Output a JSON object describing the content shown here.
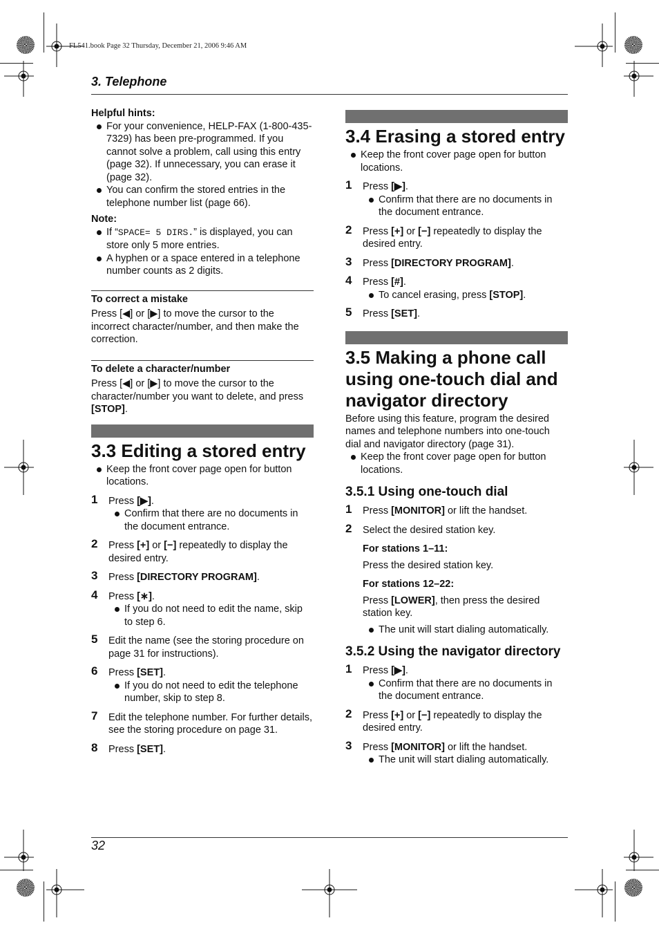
{
  "print_header": "FL541.book  Page 32  Thursday, December 21, 2006  9:46 AM",
  "chapter_title": "3. Telephone",
  "page_number": "32",
  "left": {
    "helpful_hints_title": "Helpful hints:",
    "helpful_hints": [
      "For your convenience, HELP-FAX (1-800-435-7329) has been pre-programmed. If you cannot solve a problem, call using this entry (page 32). If unnecessary, you can erase it (page 32).",
      "You can confirm the stored entries in the telephone number list (page 66)."
    ],
    "note_title": "Note:",
    "note_1_pre": "If “",
    "note_1_mono": "SPACE= 5 DIRS.",
    "note_1_post": "” is displayed, you can store only 5 more entries.",
    "note_2": "A hyphen or a space entered in a telephone number counts as 2 digits.",
    "correct_title": "To correct a mistake",
    "correct_text": "Press [◀] or [▶] to move the cursor to the incorrect character/number, and then make the correction.",
    "delete_title": "To delete a character/number",
    "delete_text_pre": "Press [◀] or [▶] to move the cursor to the character/number you want to delete, and press ",
    "delete_key": "[STOP]",
    "delete_text_post": ".",
    "section_3_3": {
      "title": "3.3 Editing a stored entry",
      "intro": "Keep the front cover page open for button locations.",
      "steps": [
        {
          "num": "1",
          "pre": "Press ",
          "key": "[▶]",
          "post": ".",
          "bullet": "Confirm that there are no documents in the document entrance."
        },
        {
          "num": "2",
          "pre": "Press ",
          "key": "[+]",
          "mid": " or ",
          "key2": "[−]",
          "post": " repeatedly to display the desired entry."
        },
        {
          "num": "3",
          "pre": "Press ",
          "key": "[DIRECTORY PROGRAM]",
          "post": "."
        },
        {
          "num": "4",
          "pre": "Press ",
          "key": "[∗]",
          "post": ".",
          "bullet": "If you do not need to edit the name, skip to step 6."
        },
        {
          "num": "5",
          "text": "Edit the name (see the storing procedure on page 31 for instructions)."
        },
        {
          "num": "6",
          "pre": "Press ",
          "key": "[SET]",
          "post": ".",
          "bullet": "If you do not need to edit the telephone number, skip to step 8."
        },
        {
          "num": "7",
          "text": "Edit the telephone number. For further details, see the storing procedure on page 31."
        },
        {
          "num": "8",
          "pre": "Press ",
          "key": "[SET]",
          "post": "."
        }
      ]
    }
  },
  "right": {
    "section_3_4": {
      "title": "3.4 Erasing a stored entry",
      "intro": "Keep the front cover page open for button locations.",
      "steps": [
        {
          "num": "1",
          "pre": "Press ",
          "key": "[▶]",
          "post": ".",
          "bullet": "Confirm that there are no documents in the document entrance."
        },
        {
          "num": "2",
          "pre": "Press ",
          "key": "[+]",
          "mid": " or ",
          "key2": "[−]",
          "post": " repeatedly to display the desired entry."
        },
        {
          "num": "3",
          "pre": "Press ",
          "key": "[DIRECTORY PROGRAM]",
          "post": "."
        },
        {
          "num": "4",
          "pre": "Press ",
          "key": "[#]",
          "post": ".",
          "bullet_pre": "To cancel erasing, press ",
          "bullet_key": "[STOP]",
          "bullet_post": "."
        },
        {
          "num": "5",
          "pre": "Press ",
          "key": "[SET]",
          "post": "."
        }
      ]
    },
    "section_3_5": {
      "title": "3.5 Making a phone call using one-touch dial and navigator directory",
      "intro": "Before using this feature, program the desired names and telephone numbers into one-touch dial and navigator directory (page 31).",
      "intro_bullet": "Keep the front cover page open for button locations.",
      "sub_1": {
        "title": "3.5.1 Using one-touch dial",
        "step1_pre": "Press ",
        "step1_key": "[MONITOR]",
        "step1_post": " or lift the handset.",
        "step2": "Select the desired station key.",
        "stations_a_label": "For stations 1–11:",
        "stations_a_text": "Press the desired station key.",
        "stations_b_label": "For stations 12–22:",
        "stations_b_pre": "Press ",
        "stations_b_key": "[LOWER]",
        "stations_b_post": ", then press the desired station key.",
        "bullet": "The unit will start dialing automatically."
      },
      "sub_2": {
        "title": "3.5.2 Using the navigator directory",
        "steps": [
          {
            "num": "1",
            "pre": "Press ",
            "key": "[▶]",
            "post": ".",
            "bullet": "Confirm that there are no documents in the document entrance."
          },
          {
            "num": "2",
            "pre": "Press ",
            "key": "[+]",
            "mid": " or ",
            "key2": "[−]",
            "post": " repeatedly to display the desired entry."
          },
          {
            "num": "3",
            "pre": "Press ",
            "key": "[MONITOR]",
            "post": " or lift the handset.",
            "bullet": "The unit will start dialing automatically."
          }
        ]
      }
    }
  }
}
